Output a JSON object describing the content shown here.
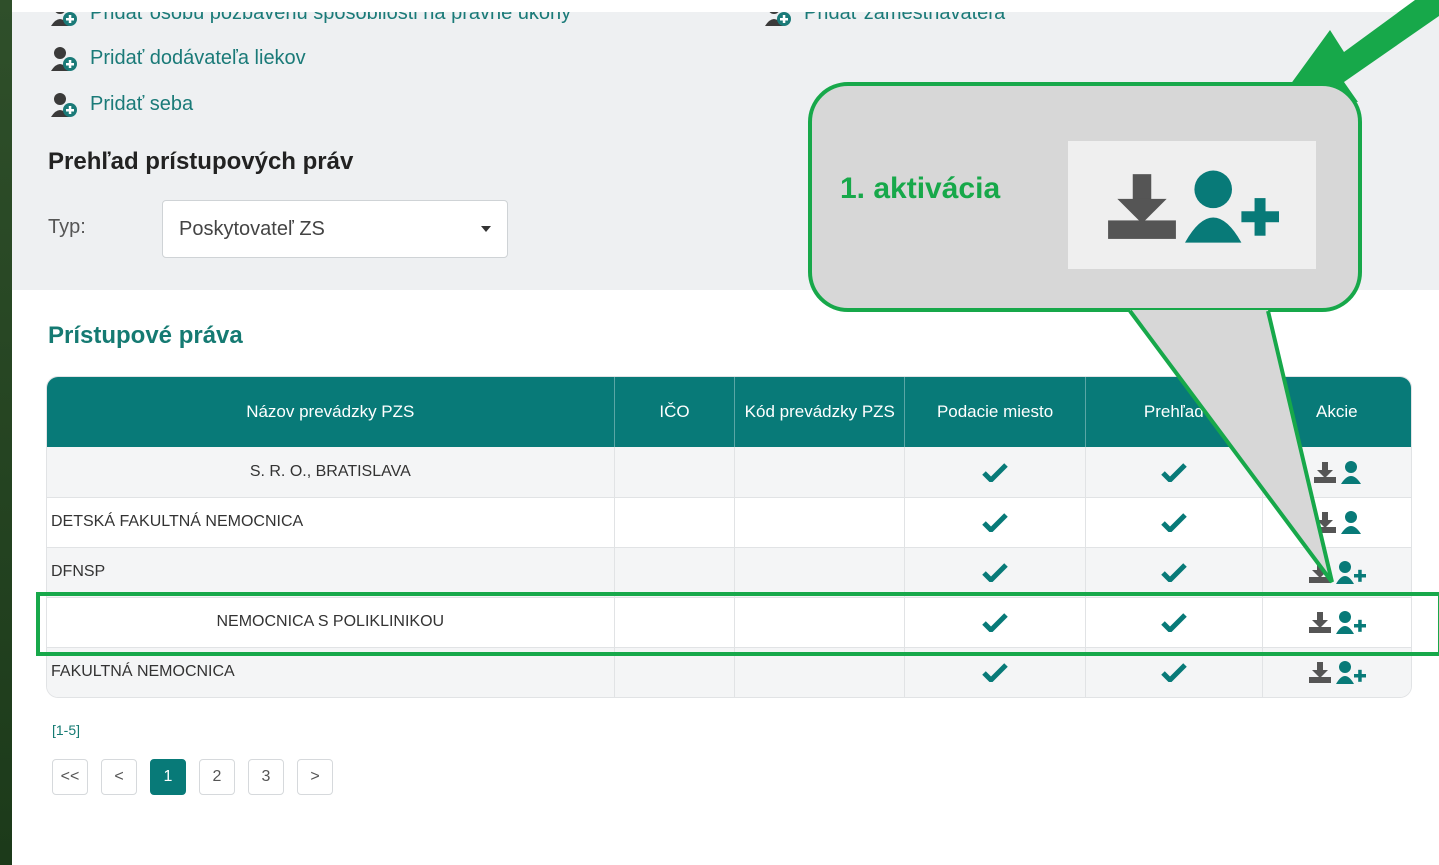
{
  "links": {
    "cut_left": "Pridať osobu pozbavenú spôsobilosti na právne úkony",
    "cut_right": "Pridať zamestnávateľa",
    "supplier": "Pridať dodávateľa liekov",
    "self": "Pridať seba"
  },
  "filter": {
    "title": "Prehľad prístupových práv",
    "type_label": "Typ:",
    "type_value": "Poskytovateľ ZS"
  },
  "table": {
    "title": "Prístupové práva",
    "headers": [
      "Názov prevádzky PZS",
      "IČO",
      "Kód prevádzky PZS",
      "Podacie miesto",
      "Prehľad",
      "Akcie"
    ],
    "rows": [
      {
        "name": "S. R. O., BRATISLAVA",
        "ico": "",
        "kod": "",
        "action": "assigned"
      },
      {
        "name": "DETSKÁ FAKULTNÁ NEMOCNICA",
        "ico": "",
        "kod": "",
        "action": "assigned"
      },
      {
        "name": "DFNSP",
        "ico": "",
        "kod": "",
        "action": "add"
      },
      {
        "name": "NEMOCNICA S POLIKLINIKOU",
        "ico": "",
        "kod": "",
        "action": "add"
      },
      {
        "name": "FAKULTNÁ NEMOCNICA",
        "ico": "",
        "kod": "",
        "action": "add"
      }
    ]
  },
  "pagination": {
    "range": "[1-5]",
    "first": "<<",
    "prev": "<",
    "pages": [
      "1",
      "2",
      "3"
    ],
    "next": ">",
    "active_page": "1"
  },
  "callout": {
    "text": "1. aktivácia"
  },
  "colors": {
    "teal": "#087a78",
    "callout_green": "#17a84a",
    "callout_bg": "#d7d7d7"
  }
}
